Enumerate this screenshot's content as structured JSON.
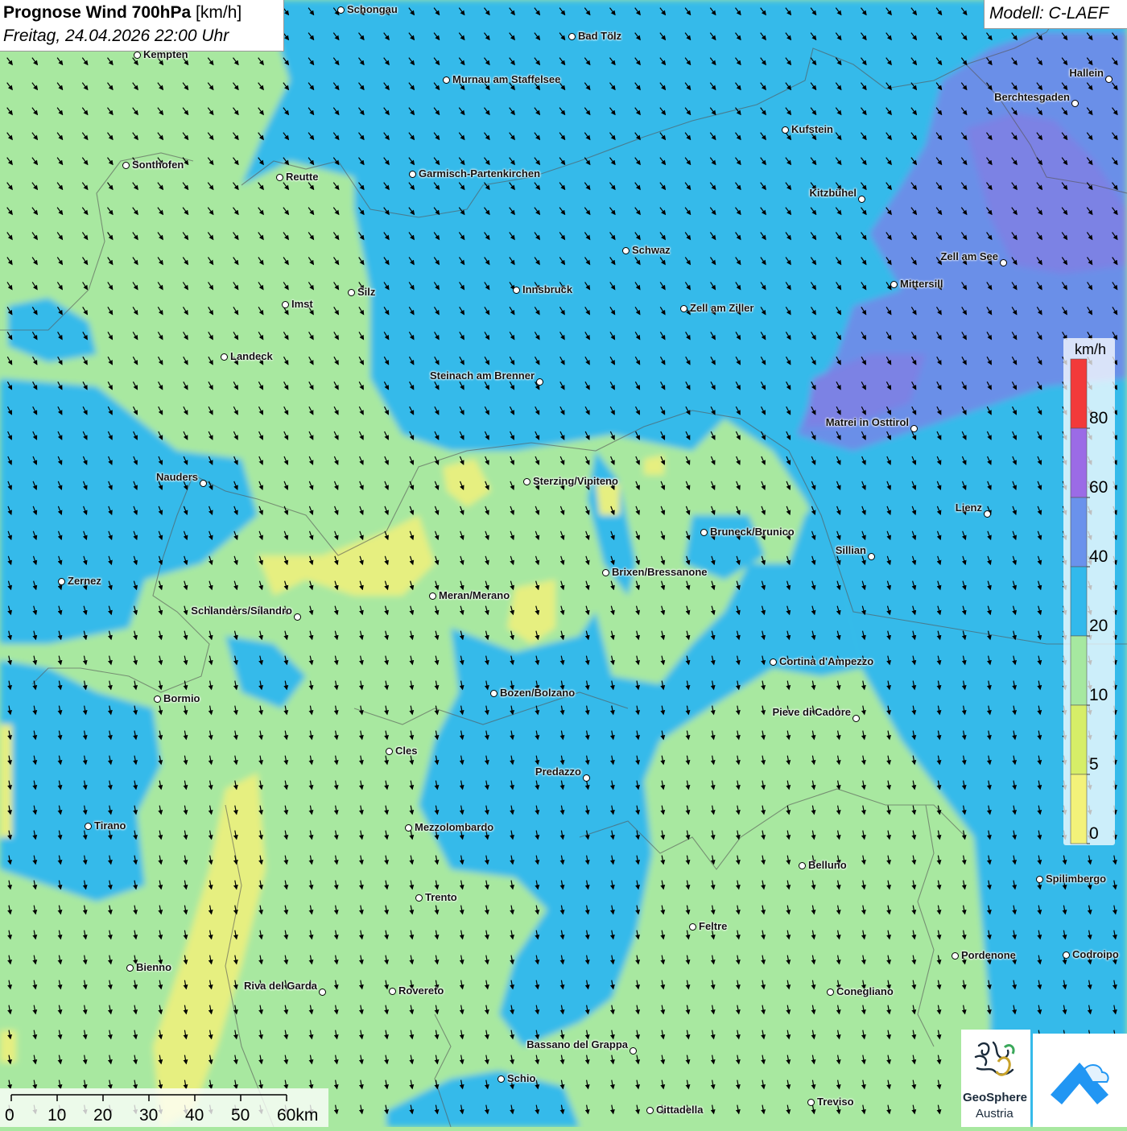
{
  "header": {
    "title": "Prognose Wind 700hPa",
    "unit": "[km/h]",
    "datetime": "Freitag, 24.04.2026 22:00 Uhr",
    "model": "Modell: C-LAEF"
  },
  "legend": {
    "unit": "km/h",
    "ticks": [
      "80",
      "60",
      "40",
      "20",
      "10",
      "5",
      "0"
    ],
    "colors": [
      "#f23a3a",
      "#9b6be6",
      "#6a92ec",
      "#32b9ec",
      "#a6e8a0",
      "#d6ee68",
      "#f3f27a"
    ]
  },
  "scale": {
    "labels": [
      "0",
      "10",
      "20",
      "30",
      "40",
      "50",
      "60km"
    ]
  },
  "logos": {
    "geosphere_line1": "GeoSphere",
    "geosphere_line2": "Austria",
    "brand_color": "#2196f3"
  },
  "colors": {
    "green": "#a8e8a0",
    "light_blue": "#34baea",
    "blue": "#5aa6ec",
    "purple": "#7c82e4",
    "yellow": "#e6ef80"
  },
  "cities": [
    {
      "name": "Schongau"
    },
    {
      "name": "Bad Tölz"
    },
    {
      "name": "Kempten"
    },
    {
      "name": "Murnau am Staffelsee"
    },
    {
      "name": "Hallein"
    },
    {
      "name": "Berchtesgaden"
    },
    {
      "name": "Kufstein"
    },
    {
      "name": "Sonthofen"
    },
    {
      "name": "Reutte"
    },
    {
      "name": "Garmisch-Partenkirchen"
    },
    {
      "name": "Kitzbühel"
    },
    {
      "name": "Schwaz"
    },
    {
      "name": "Zell am See"
    },
    {
      "name": "Mittersill"
    },
    {
      "name": "Innsbruck"
    },
    {
      "name": "Silz"
    },
    {
      "name": "Imst"
    },
    {
      "name": "Zell am Ziller"
    },
    {
      "name": "Landeck"
    },
    {
      "name": "Steinach am Brenner"
    },
    {
      "name": "Matrei in Osttirol"
    },
    {
      "name": "Nauders"
    },
    {
      "name": "Sterzing/Vipiteno"
    },
    {
      "name": "Lienz"
    },
    {
      "name": "Bruneck/Brunico"
    },
    {
      "name": "Sillian"
    },
    {
      "name": "Brixen/Bressanone"
    },
    {
      "name": "Zernez"
    },
    {
      "name": "Meran/Merano"
    },
    {
      "name": "Schlanders/Silandro"
    },
    {
      "name": "Cortina d'Ampezzo"
    },
    {
      "name": "Bozen/Bolzano"
    },
    {
      "name": "Bormio"
    },
    {
      "name": "Pieve di Cadore"
    },
    {
      "name": "Cles"
    },
    {
      "name": "Predazzo"
    },
    {
      "name": "Tirano"
    },
    {
      "name": "Mezzolombardo"
    },
    {
      "name": "Belluno"
    },
    {
      "name": "Spilimbergo"
    },
    {
      "name": "Trento"
    },
    {
      "name": "Feltre"
    },
    {
      "name": "Bienno"
    },
    {
      "name": "Pordenone"
    },
    {
      "name": "Codroipo"
    },
    {
      "name": "Riva del Garda"
    },
    {
      "name": "Rovereto"
    },
    {
      "name": "Conegliano"
    },
    {
      "name": "Bassano del Grappa"
    },
    {
      "name": "Schio"
    },
    {
      "name": "Treviso"
    },
    {
      "name": "Cittadella"
    }
  ]
}
